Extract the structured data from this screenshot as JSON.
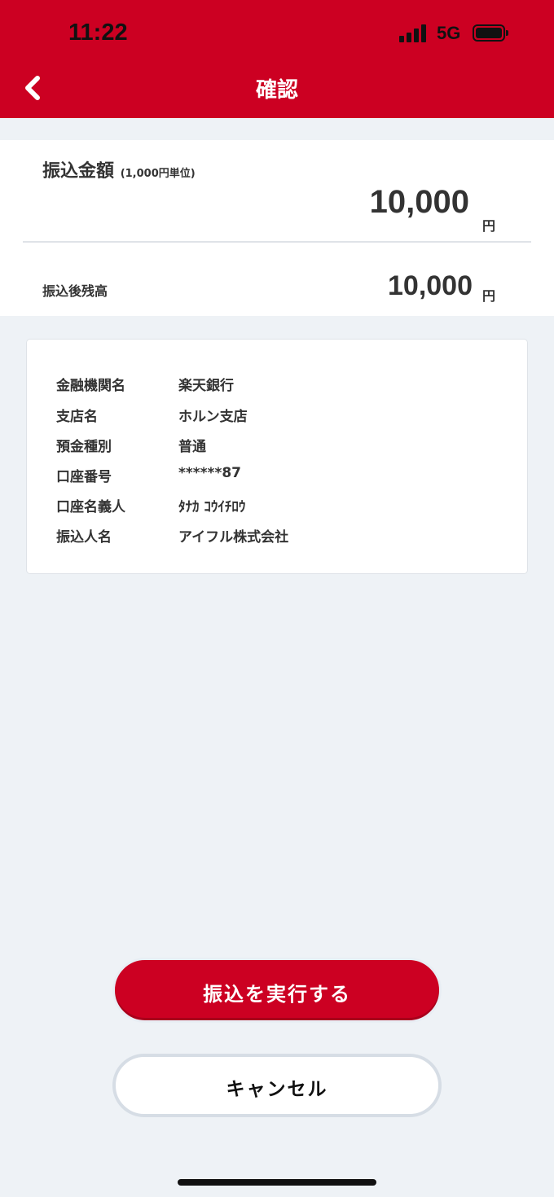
{
  "status_bar": {
    "time": "11:22",
    "network": "5G"
  },
  "header": {
    "title": "確認"
  },
  "transfer": {
    "amount_label": "振込金額",
    "amount_unit_note": "(1,000円単位)",
    "amount_value": "10,000",
    "currency": "円",
    "balance_label": "振込後残高",
    "balance_value": "10,000"
  },
  "details": [
    {
      "key": "金融機関名",
      "value": "楽天銀行"
    },
    {
      "key": "支店名",
      "value": "ホルン支店"
    },
    {
      "key": "預金種別",
      "value": "普通"
    },
    {
      "key": "口座番号",
      "value": "******87"
    },
    {
      "key": "口座名義人",
      "value": "ﾀﾅｶ ｺｳｲﾁﾛｳ"
    },
    {
      "key": "振込人名",
      "value": "アイフル株式会社"
    }
  ],
  "actions": {
    "execute_label": "振込を実行する",
    "cancel_label": "キャンセル"
  },
  "colors": {
    "brand": "#cc0022",
    "background": "#eef2f6"
  },
  "icons": {
    "back": "chevron-left-icon"
  }
}
